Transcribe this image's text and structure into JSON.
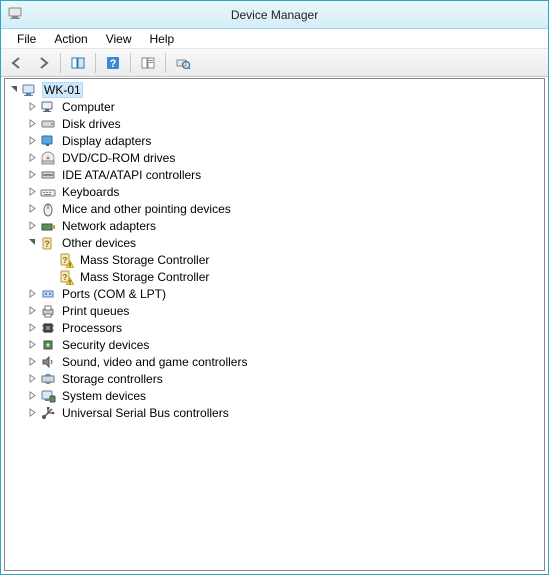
{
  "window": {
    "title": "Device Manager"
  },
  "menu": {
    "file": "File",
    "action": "Action",
    "view": "View",
    "help": "Help"
  },
  "tree": {
    "root": {
      "label": "WK-01",
      "expanded": true
    },
    "categories": [
      {
        "id": "computer",
        "label": "Computer",
        "icon": "computer-icon",
        "expanded": false
      },
      {
        "id": "disk-drives",
        "label": "Disk drives",
        "icon": "disk-drive-icon",
        "expanded": false
      },
      {
        "id": "display-adapters",
        "label": "Display adapters",
        "icon": "display-adapter-icon",
        "expanded": false
      },
      {
        "id": "dvd-cdrom",
        "label": "DVD/CD-ROM drives",
        "icon": "optical-drive-icon",
        "expanded": false
      },
      {
        "id": "ide-ata",
        "label": "IDE ATA/ATAPI controllers",
        "icon": "ide-controller-icon",
        "expanded": false
      },
      {
        "id": "keyboards",
        "label": "Keyboards",
        "icon": "keyboard-icon",
        "expanded": false
      },
      {
        "id": "mice",
        "label": "Mice and other pointing devices",
        "icon": "mouse-icon",
        "expanded": false
      },
      {
        "id": "network",
        "label": "Network adapters",
        "icon": "network-adapter-icon",
        "expanded": false
      },
      {
        "id": "other",
        "label": "Other devices",
        "icon": "unknown-device-icon",
        "expanded": true,
        "children": [
          {
            "id": "mass1",
            "label": "Mass Storage Controller",
            "icon": "unknown-device-warning-icon"
          },
          {
            "id": "mass2",
            "label": "Mass Storage Controller",
            "icon": "unknown-device-warning-icon"
          }
        ]
      },
      {
        "id": "ports",
        "label": "Ports (COM & LPT)",
        "icon": "port-icon",
        "expanded": false
      },
      {
        "id": "print-queues",
        "label": "Print queues",
        "icon": "printer-icon",
        "expanded": false
      },
      {
        "id": "processors",
        "label": "Processors",
        "icon": "processor-icon",
        "expanded": false
      },
      {
        "id": "security",
        "label": "Security devices",
        "icon": "security-device-icon",
        "expanded": false
      },
      {
        "id": "sound",
        "label": "Sound, video and game controllers",
        "icon": "sound-device-icon",
        "expanded": false
      },
      {
        "id": "storage-controllers",
        "label": "Storage controllers",
        "icon": "storage-controller-icon",
        "expanded": false
      },
      {
        "id": "system-devices",
        "label": "System devices",
        "icon": "system-device-icon",
        "expanded": false
      },
      {
        "id": "usb",
        "label": "Universal Serial Bus controllers",
        "icon": "usb-controller-icon",
        "expanded": false
      }
    ]
  }
}
